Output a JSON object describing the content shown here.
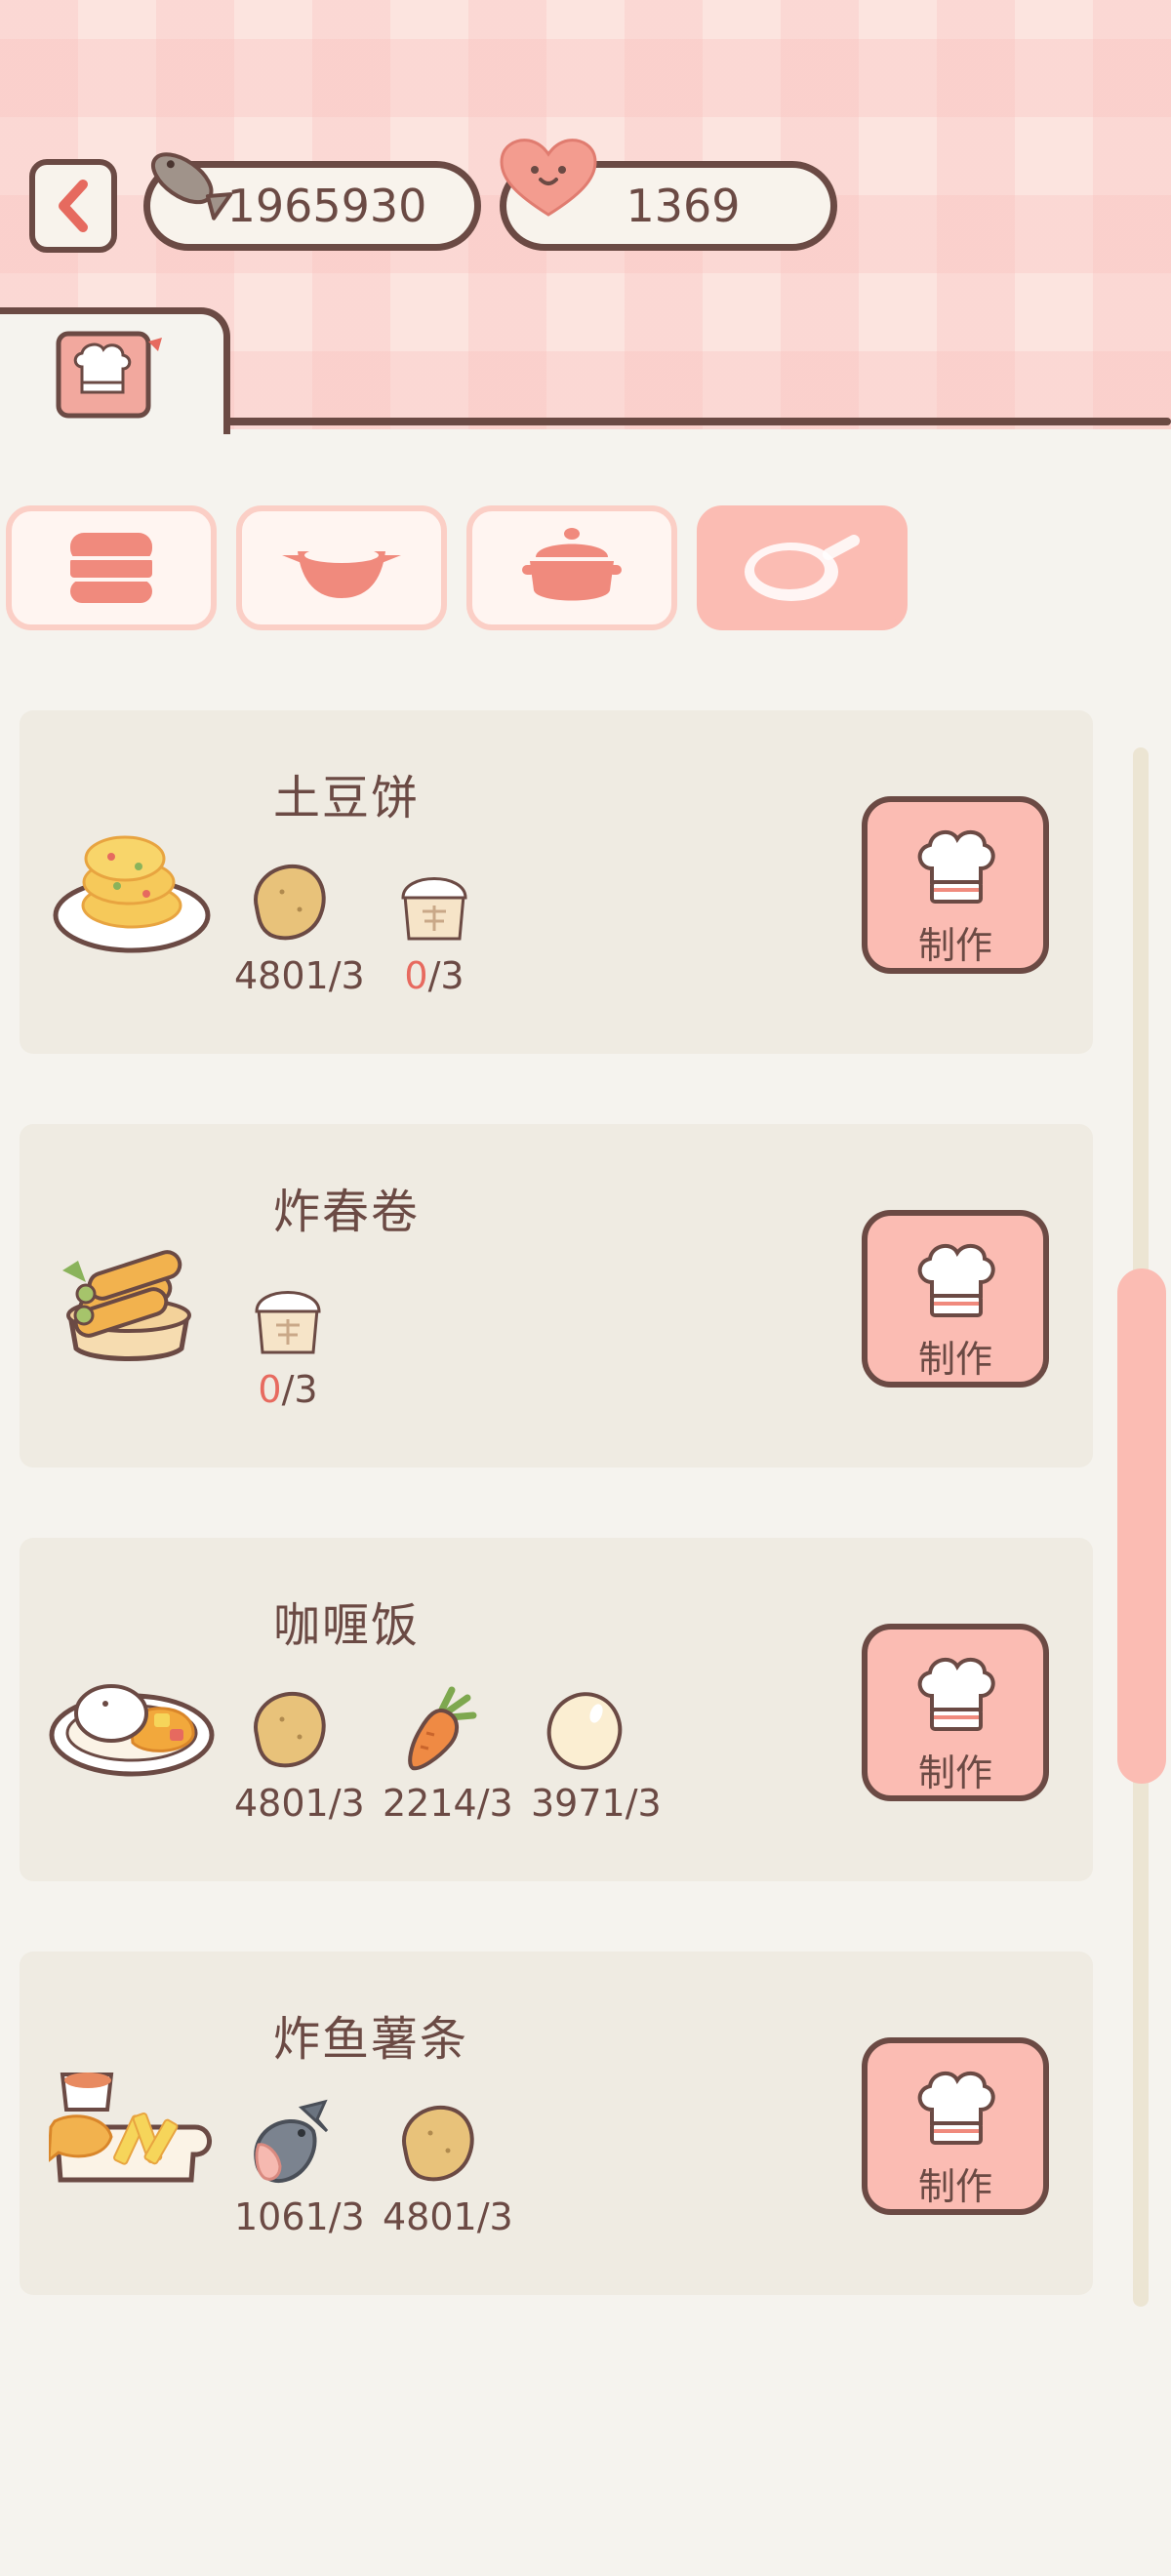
{
  "header": {
    "fish_count": "1965930",
    "heart_count": "1369",
    "icons": {
      "back": "chevron-left-icon",
      "fish": "fish-icon",
      "heart": "heart-icon",
      "tab": "chef-recipe-book-icon"
    }
  },
  "categories": [
    {
      "icon": "steamer-icon",
      "selected": false
    },
    {
      "icon": "wok-icon",
      "selected": false
    },
    {
      "icon": "pot-icon",
      "selected": false
    },
    {
      "icon": "frying-pan-icon",
      "selected": true
    }
  ],
  "recipes": [
    {
      "name": "土豆饼",
      "dish_icon": "potato-pancake-icon",
      "ingredients": [
        {
          "icon": "potato-icon",
          "have": "4801",
          "need": "/3"
        },
        {
          "icon": "flour-icon",
          "have": "0",
          "need": "/3"
        }
      ],
      "button": "制作"
    },
    {
      "name": "炸春卷",
      "dish_icon": "spring-rolls-icon",
      "ingredients": [
        {
          "icon": "flour-icon",
          "have": "0",
          "need": "/3"
        }
      ],
      "button": "制作"
    },
    {
      "name": "咖喱饭",
      "dish_icon": "curry-rice-icon",
      "ingredients": [
        {
          "icon": "potato-icon",
          "have": "4801",
          "need": "/3"
        },
        {
          "icon": "carrot-icon",
          "have": "2214",
          "need": "/3"
        },
        {
          "icon": "egg-icon",
          "have": "3971",
          "need": "/3"
        }
      ],
      "button": "制作"
    },
    {
      "name": "炸鱼薯条",
      "dish_icon": "fish-and-chips-icon",
      "ingredients": [
        {
          "icon": "fish-icon",
          "have": "1061",
          "need": "/3"
        },
        {
          "icon": "potato-icon",
          "have": "4801",
          "need": "/3"
        }
      ],
      "button": "制作"
    }
  ],
  "colors": {
    "accent": "#fbbcb3",
    "outline": "#6b4a44",
    "missing": "#e76a5f",
    "card": "#efebe2",
    "background": "#f5f3ee"
  }
}
